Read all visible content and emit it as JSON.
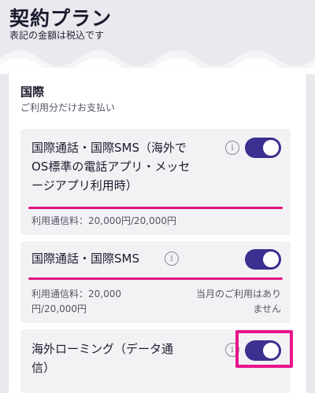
{
  "header": {
    "title": "契約プラン",
    "subtitle": "表記の金額は税込です"
  },
  "section": {
    "title": "国際",
    "subtitle": "ご利用分だけお支払い"
  },
  "cards": [
    {
      "title": "国際通話・国際SMS（海外で\nOS標準の電話アプリ・メッセ\nージアプリ利用時）",
      "info_icon": "info-icon",
      "toggle_on": true,
      "usage_ratio": 1.0,
      "usage_text": "利用通信料：20,000円/20,000円"
    },
    {
      "title": "国際通話・国際SMS",
      "info_icon": "info-icon",
      "toggle_on": true,
      "usage_ratio": 1.0,
      "usage_text": "利用通信料：20,000\n円/20,000円",
      "note": "当月のご利用はあり\nません"
    },
    {
      "title": "海外ローミング（データ通\n信）",
      "info_icon": "info-icon",
      "toggle_on": true
    }
  ],
  "colors": {
    "accent": "#3b2f8f",
    "usage_bar": "#e0117f",
    "highlight": "#e8158a",
    "background": "#e9e9ee"
  }
}
